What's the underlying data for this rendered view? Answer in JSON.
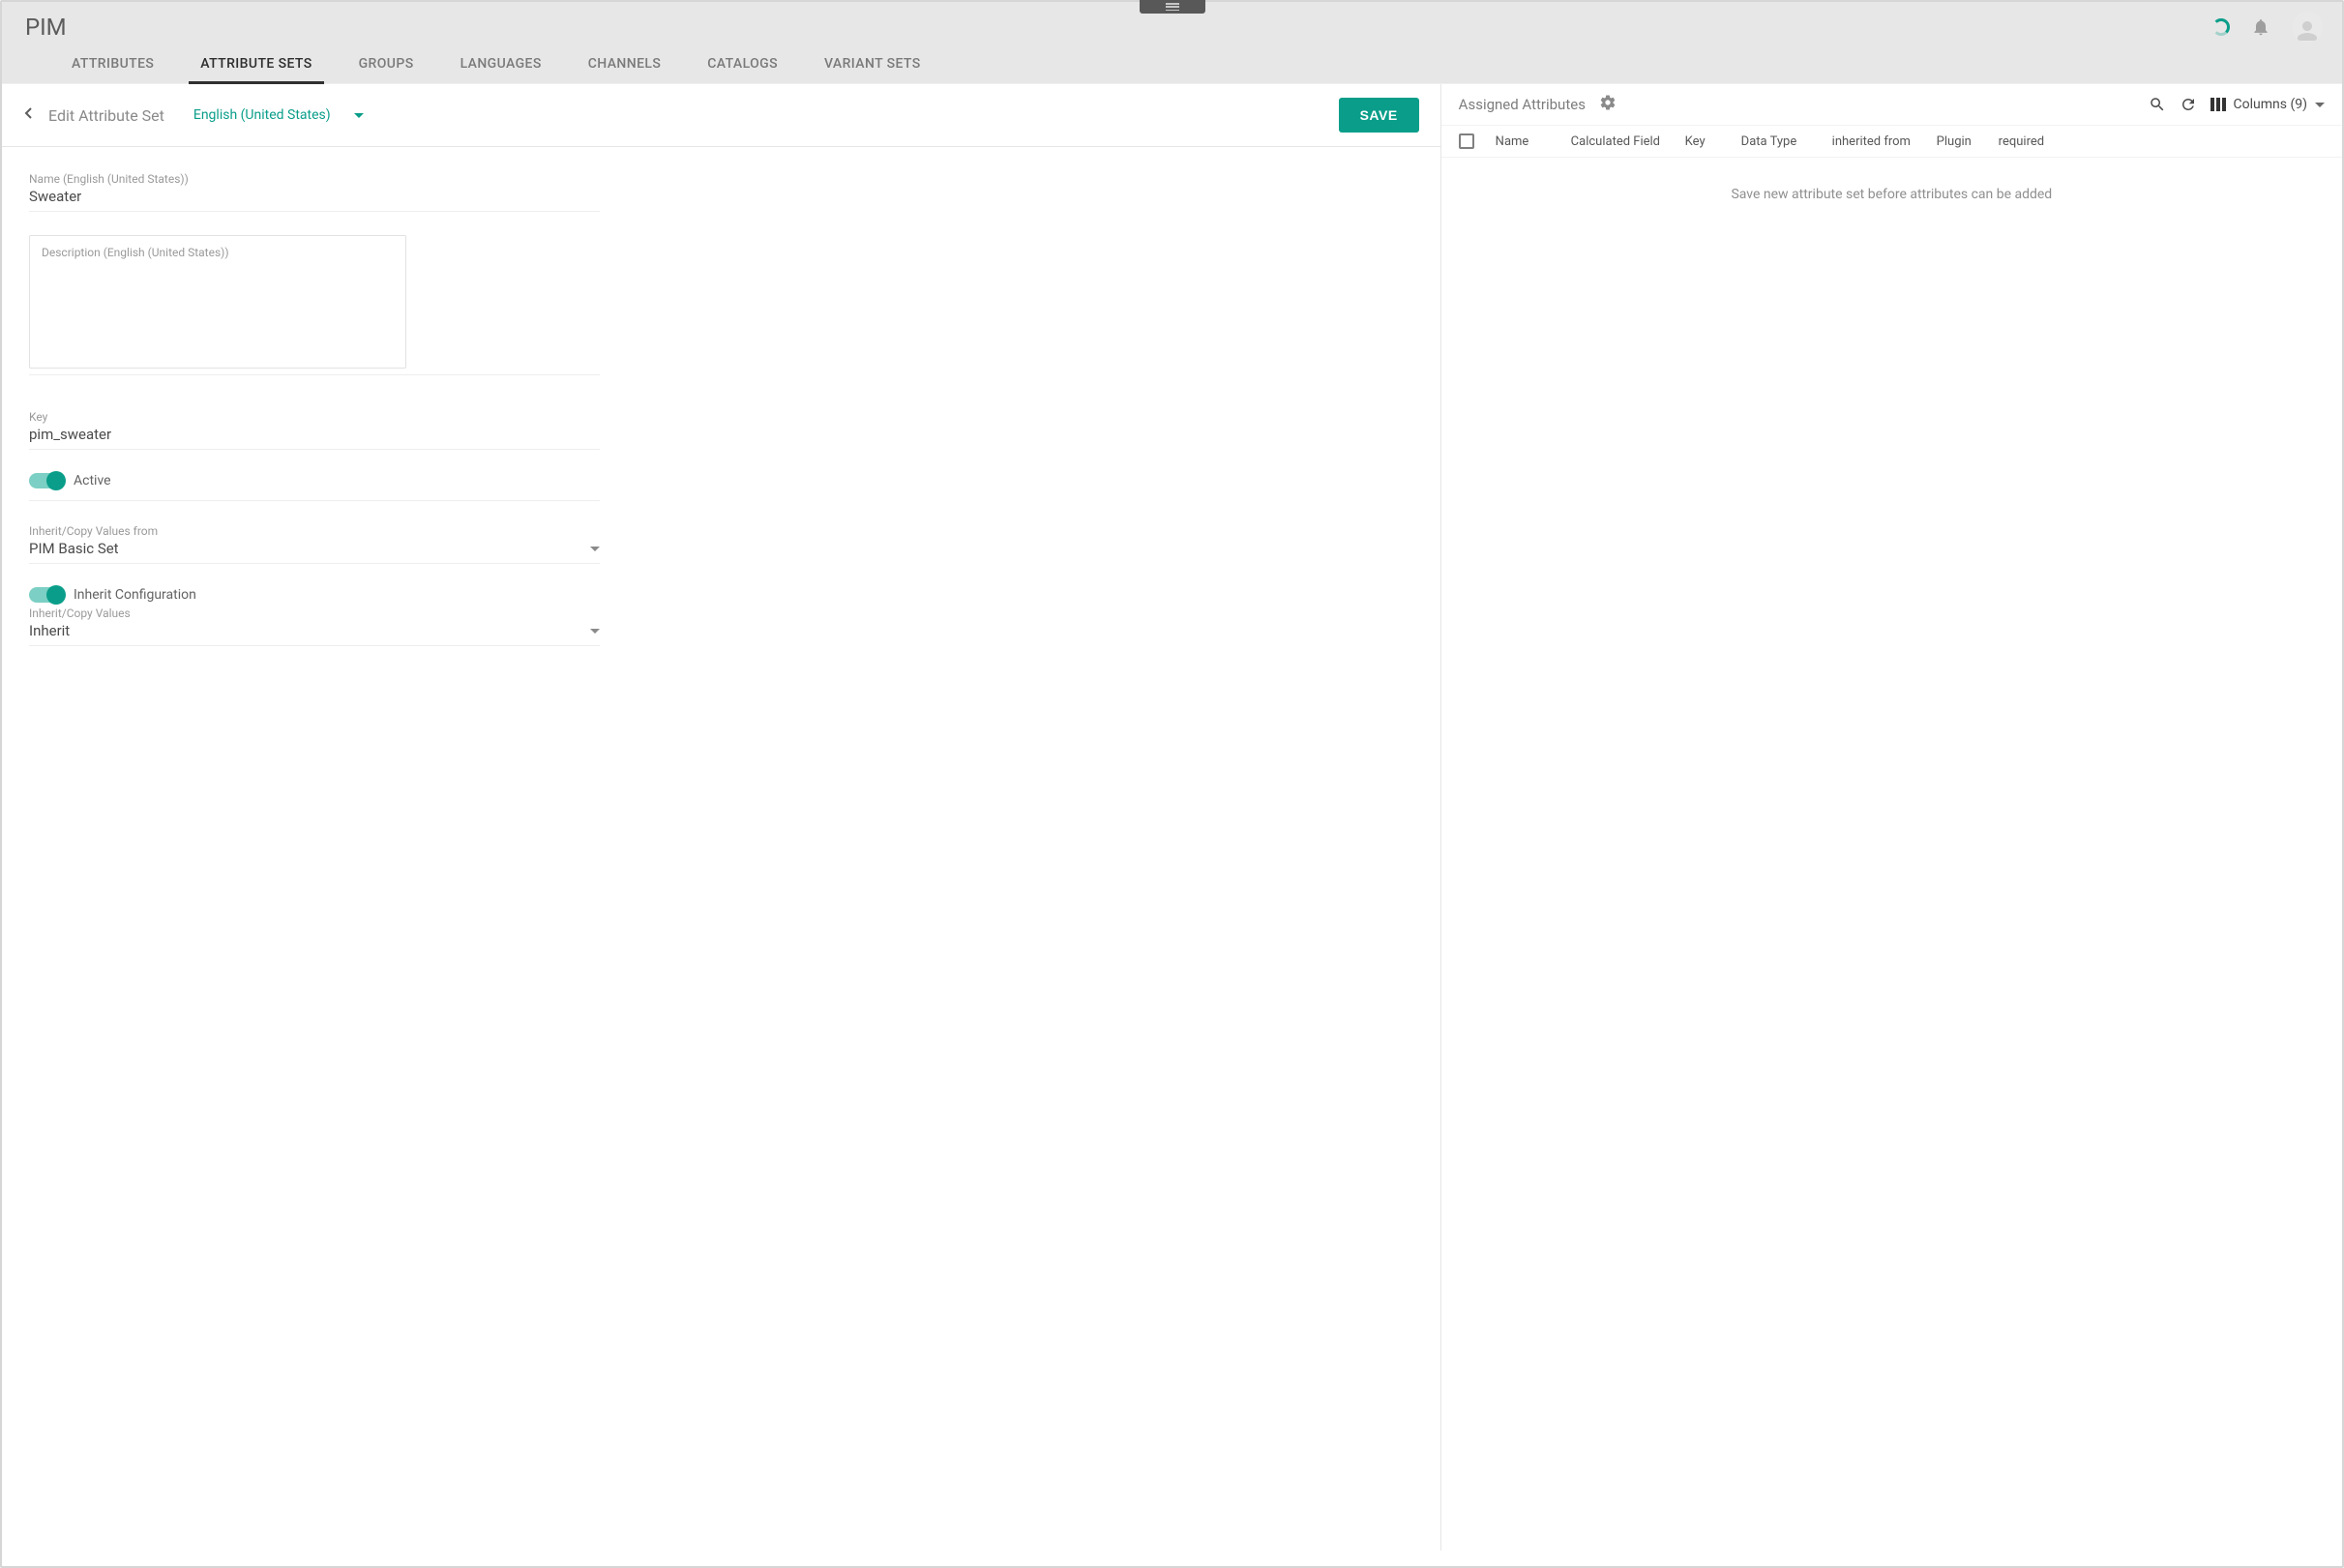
{
  "app": {
    "title": "PIM"
  },
  "tabs": [
    {
      "label": "ATTRIBUTES",
      "active": false
    },
    {
      "label": "ATTRIBUTE SETS",
      "active": true
    },
    {
      "label": "GROUPS",
      "active": false
    },
    {
      "label": "LANGUAGES",
      "active": false
    },
    {
      "label": "CHANNELS",
      "active": false
    },
    {
      "label": "CATALOGS",
      "active": false
    },
    {
      "label": "VARIANT SETS",
      "active": false
    }
  ],
  "page": {
    "title": "Edit Attribute Set",
    "language": "English (United States)",
    "save_label": "SAVE"
  },
  "form": {
    "name_label": "Name (English (United States))",
    "name_value": "Sweater",
    "description_label": "Description (English (United States))",
    "description_value": "",
    "key_label": "Key",
    "key_value": "pim_sweater",
    "active_label": "Active",
    "active_on": true,
    "inherit_from_label": "Inherit/Copy Values from",
    "inherit_from_value": "PIM Basic Set",
    "inherit_config_label": "Inherit Configuration",
    "inherit_config_on": true,
    "inherit_mode_label": "Inherit/Copy Values",
    "inherit_mode_value": "Inherit"
  },
  "right": {
    "title": "Assigned Attributes",
    "columns_label": "Columns (9)",
    "empty_message": "Save new attribute set before attributes can be added",
    "columns": {
      "name": "Name",
      "calculated": "Calculated Field",
      "key": "Key",
      "data_type": "Data Type",
      "inherited_from": "inherited from",
      "plugin": "Plugin",
      "required": "required"
    }
  }
}
